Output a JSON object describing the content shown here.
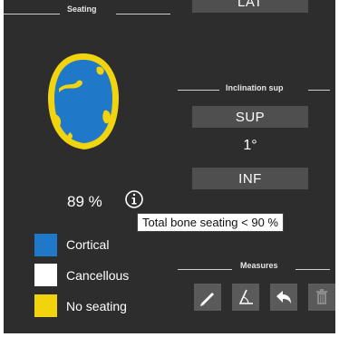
{
  "seating": {
    "title": "Seating",
    "percentage": "89 %",
    "info_icon": "info-circle-icon",
    "tooltip": "Total bone seating < 90 %",
    "legend": [
      {
        "label": "Cortical",
        "color": "#1f78c8"
      },
      {
        "label": "Cancellous",
        "color": "#ffffff"
      },
      {
        "label": "No seating",
        "color": "#f2d40e"
      }
    ]
  },
  "top_button": {
    "label": "LAT"
  },
  "inclination": {
    "title": "Inclination sup",
    "sup_label": "SUP",
    "value": "1°",
    "inf_label": "INF"
  },
  "measures": {
    "title": "Measures",
    "tools": [
      {
        "icon": "ruler-pen-icon"
      },
      {
        "icon": "angle-icon"
      },
      {
        "icon": "undo-arrow-icon"
      },
      {
        "icon": "trash-icon"
      }
    ]
  },
  "colors": {
    "panel": "#2d2d2d",
    "button": "#4f4f4f",
    "accent_blue": "#1f78c8",
    "accent_yellow": "#f2d40e"
  }
}
